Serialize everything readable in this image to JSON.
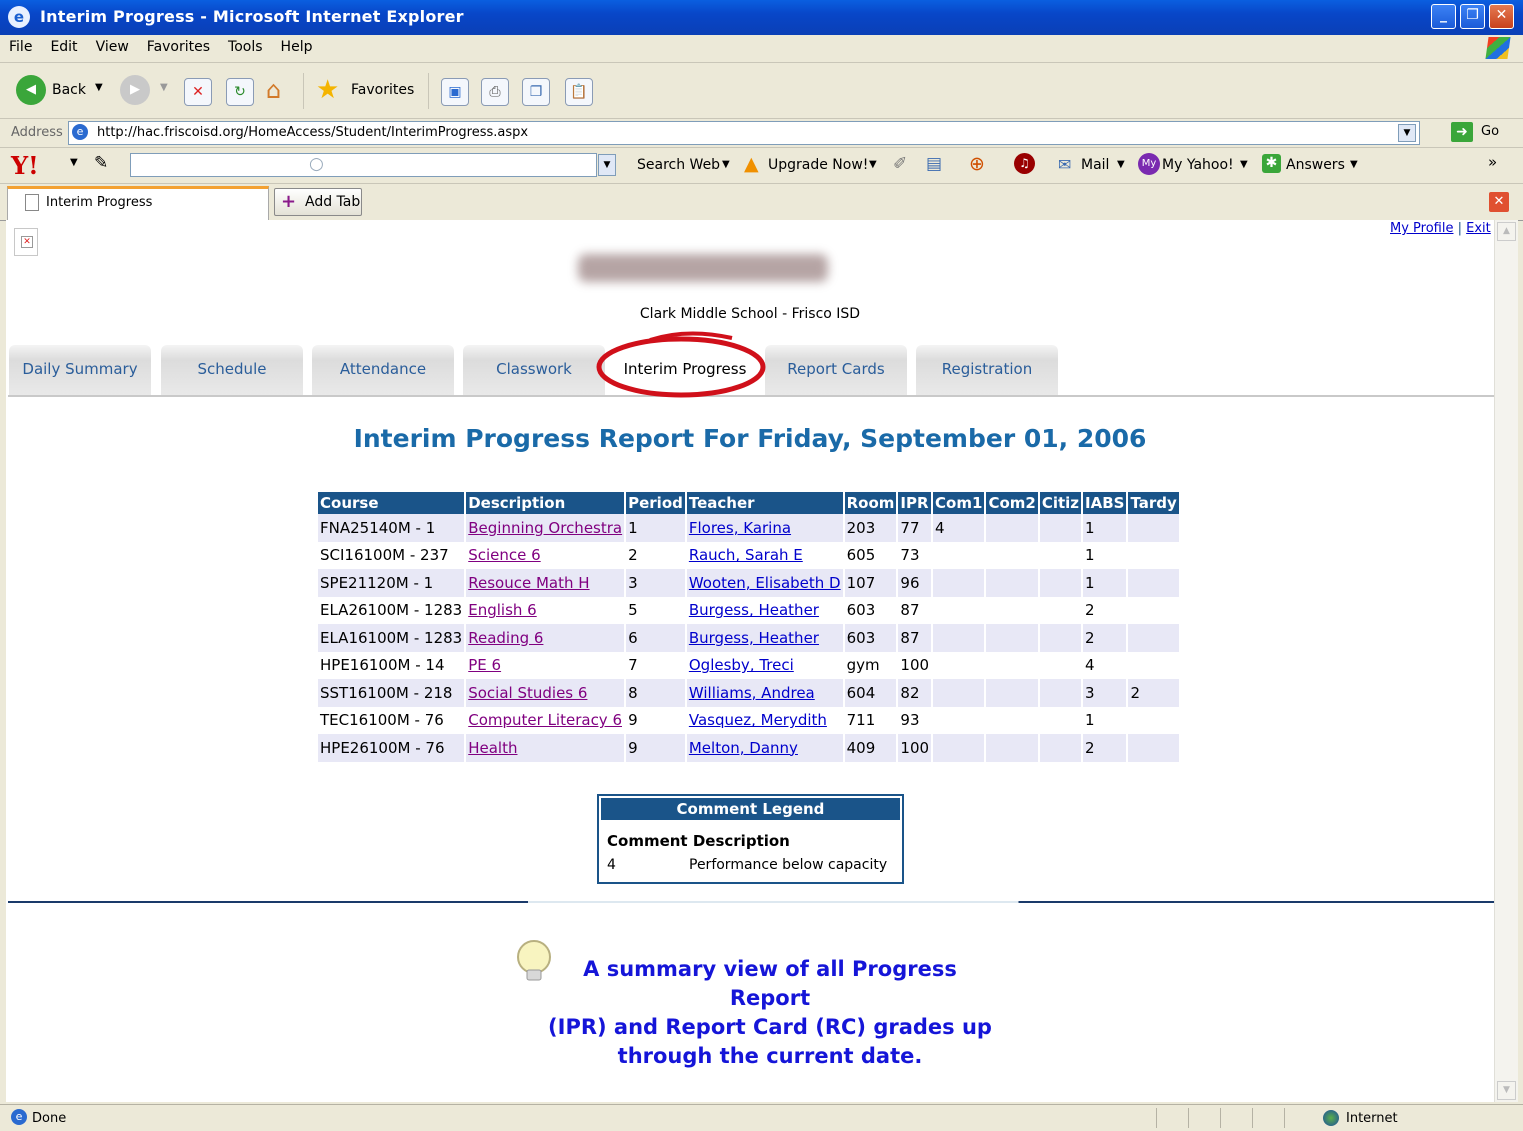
{
  "window": {
    "title": "Interim Progress - Microsoft Internet Explorer",
    "ie_icon": "ie-logo-icon"
  },
  "menu": [
    "File",
    "Edit",
    "View",
    "Favorites",
    "Tools",
    "Help"
  ],
  "toolbar": {
    "back_label": "Back",
    "favorites_label": "Favorites"
  },
  "address": {
    "label": "Address",
    "url": "http://hac.friscoisd.org/HomeAccess/Student/InterimProgress.aspx",
    "go_label": "Go"
  },
  "yahoo": {
    "logo": "Y!",
    "search_web": "Search Web",
    "upgrade": "Upgrade Now!",
    "mail": "Mail",
    "my_yahoo": "My Yahoo!",
    "answers": "Answers",
    "more": "»"
  },
  "tabs": {
    "active_label": "Interim Progress",
    "add_tab_label": "Add Tab"
  },
  "page": {
    "my_profile": "My Profile",
    "separator": "|",
    "exit": "Exit",
    "school": "Clark Middle School - Frisco ISD",
    "nav_tabs": [
      "Daily Summary",
      "Schedule",
      "Attendance",
      "Classwork",
      "Interim Progress",
      "Report Cards",
      "Registration"
    ],
    "active_nav": "Interim Progress",
    "heading": "Interim Progress Report For Friday, September 01, 2006",
    "table": {
      "headers": [
        "Course",
        "Description",
        "Period",
        "Teacher",
        "Room",
        "IPR",
        "Com1",
        "Com2",
        "Citiz",
        "IABS",
        "Tardy"
      ],
      "rows": [
        [
          "FNA25140M - 1",
          "Beginning Orchestra",
          "1",
          "Flores, Karina",
          "203",
          "77",
          "4",
          "",
          "",
          "1",
          ""
        ],
        [
          "SCI16100M - 237",
          "Science 6",
          "2",
          "Rauch, Sarah E",
          "605",
          "73",
          "",
          "",
          "",
          "1",
          ""
        ],
        [
          "SPE21120M - 1",
          "Resouce Math H",
          "3",
          "Wooten, Elisabeth D",
          "107",
          "96",
          "",
          "",
          "",
          "1",
          ""
        ],
        [
          "ELA26100M - 1283",
          "English 6",
          "5",
          "Burgess, Heather",
          "603",
          "87",
          "",
          "",
          "",
          "2",
          ""
        ],
        [
          "ELA16100M - 1283",
          "Reading 6",
          "6",
          "Burgess, Heather",
          "603",
          "87",
          "",
          "",
          "",
          "2",
          ""
        ],
        [
          "HPE16100M - 14",
          "PE 6",
          "7",
          "Oglesby, Treci",
          "gym",
          "100",
          "",
          "",
          "",
          "4",
          ""
        ],
        [
          "SST16100M - 218",
          "Social Studies 6",
          "8",
          "Williams, Andrea",
          "604",
          "82",
          "",
          "",
          "",
          "3",
          "2"
        ],
        [
          "TEC16100M - 76",
          "Computer Literacy 6",
          "9",
          "Vasquez, Merydith",
          "711",
          "93",
          "",
          "",
          "",
          "1",
          ""
        ],
        [
          "HPE26100M - 76",
          "Health",
          "9",
          "Melton, Danny",
          "409",
          "100",
          "",
          "",
          "",
          "2",
          ""
        ]
      ]
    },
    "legend": {
      "title": "Comment Legend",
      "col1": "Comment",
      "col2": "Description",
      "code": "4",
      "desc": "Performance below capacity"
    },
    "tip": {
      "line1": "A summary view of all Progress Report",
      "line2": "(IPR) and Report Card (RC) grades up",
      "line3": "through the current date."
    }
  },
  "status": {
    "text": "Done",
    "zone": "Internet"
  },
  "colors": {
    "heading": "#1a6aa8",
    "table_header": "#1a5489",
    "row_alt": "#e8e8f6",
    "tip_text": "#1515d8",
    "highlight_ellipse": "#d0101a"
  }
}
